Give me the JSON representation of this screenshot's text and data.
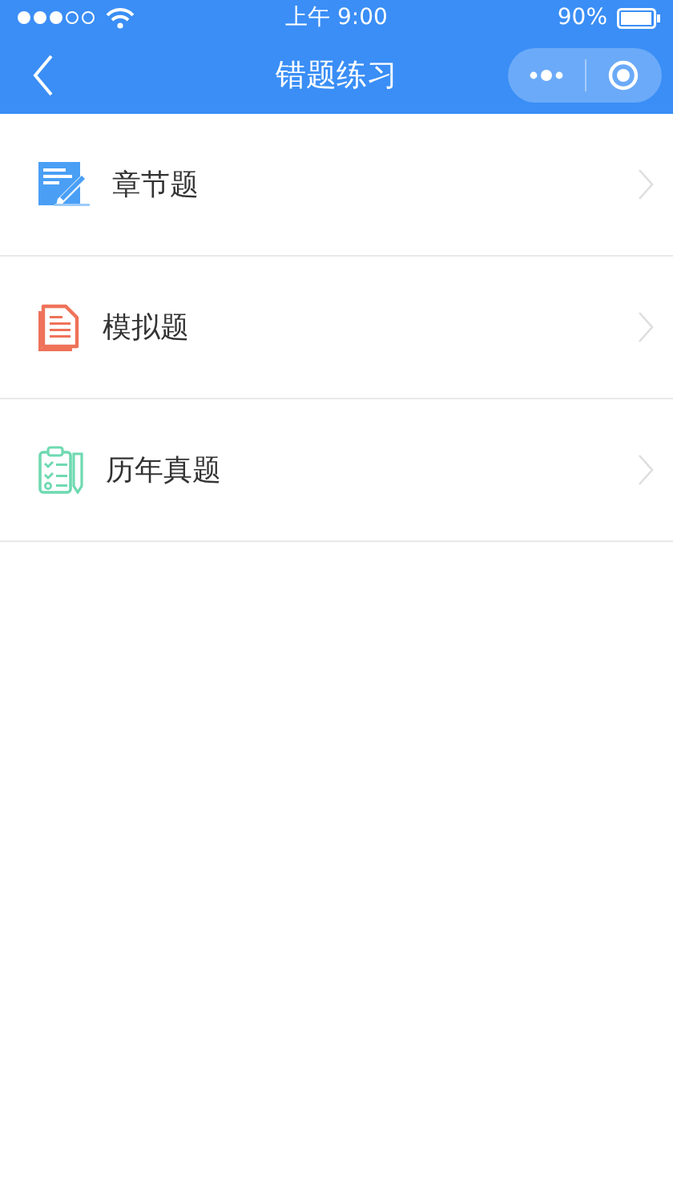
{
  "status_bar": {
    "time": "上午 9:00",
    "battery": "90%"
  },
  "nav_bar": {
    "title": "错题练习"
  },
  "items": [
    {
      "kind": "chapter",
      "label": "章节题"
    },
    {
      "kind": "mock",
      "label": "模拟题"
    },
    {
      "kind": "past",
      "label": "历年真题"
    }
  ]
}
